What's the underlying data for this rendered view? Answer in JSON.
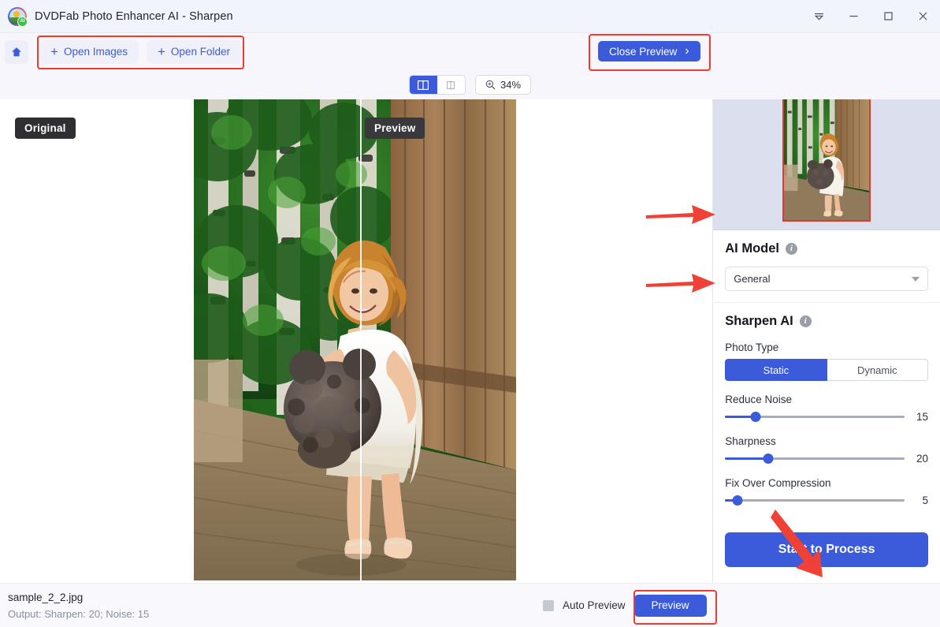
{
  "window": {
    "title": "DVDFab Photo Enhancer AI - Sharpen",
    "logo_icon": "dvdfab-ai-logo-icon",
    "logo_badge": "AI",
    "controls": [
      {
        "name": "collapse-menu-icon",
        "glyph": "collapse"
      },
      {
        "name": "minimize-icon",
        "glyph": "minimize"
      },
      {
        "name": "maximize-icon",
        "glyph": "maximize"
      },
      {
        "name": "close-icon",
        "glyph": "close"
      }
    ]
  },
  "toolbar": {
    "home_icon": "home-icon",
    "open_images_label": "Open Images",
    "open_folder_label": "Open Folder",
    "plus_glyph": "+",
    "close_preview_label": "Close Preview",
    "close_preview_chevron": "›"
  },
  "viewbar": {
    "split_view_icon": "split-view-icon",
    "single_view_icon": "single-view-icon",
    "zoom_icon": "zoom-in-icon",
    "zoom_level": "34%"
  },
  "canvas": {
    "original_badge": "Original",
    "preview_badge": "Preview"
  },
  "panel": {
    "thumbnail_name": "image-thumbnail",
    "ai_model": {
      "title": "AI Model",
      "info_icon": "info-icon",
      "selected": "General"
    },
    "sharpen_ai": {
      "title": "Sharpen AI",
      "info_icon": "info-icon",
      "photo_type_label": "Photo Type",
      "photo_type_options": [
        "Static",
        "Dynamic"
      ],
      "photo_type_selected": "Static",
      "sliders": [
        {
          "label": "Reduce Noise",
          "value": "15",
          "percent": 17
        },
        {
          "label": "Sharpness",
          "value": "20",
          "percent": 24
        },
        {
          "label": "Fix Over Compression",
          "value": "5",
          "percent": 7
        }
      ]
    },
    "start_button": "Start to Process"
  },
  "status": {
    "file_name": "sample_2_2.jpg",
    "output_info": "Output: Sharpen: 20; Noise: 15",
    "auto_preview_label": "Auto Preview",
    "auto_preview_checked": false,
    "preview_label": "Preview"
  },
  "annotations": {
    "accent_color": "#ef3b2d",
    "highlight_boxes": [
      "open-buttons-highlight",
      "close-preview-highlight",
      "preview-button-highlight"
    ],
    "arrows": [
      "arrow-to-ai-model",
      "arrow-to-sharpen-ai",
      "arrow-to-start-process"
    ]
  },
  "colors": {
    "brand_blue": "#3b5bdb",
    "titlebar_bg": "#f2f4fc",
    "toolbar_bg": "#f6f6fc",
    "panel_bg": "#ffffff",
    "thumbstrip_bg": "#dcdfee"
  }
}
